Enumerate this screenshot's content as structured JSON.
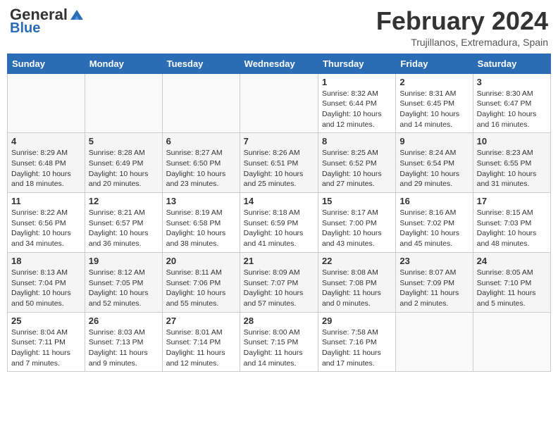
{
  "header": {
    "logo_general": "General",
    "logo_blue": "Blue",
    "month_year": "February 2024",
    "location": "Trujillanos, Extremadura, Spain"
  },
  "weekdays": [
    "Sunday",
    "Monday",
    "Tuesday",
    "Wednesday",
    "Thursday",
    "Friday",
    "Saturday"
  ],
  "weeks": [
    [
      {
        "day": "",
        "info": ""
      },
      {
        "day": "",
        "info": ""
      },
      {
        "day": "",
        "info": ""
      },
      {
        "day": "",
        "info": ""
      },
      {
        "day": "1",
        "info": "Sunrise: 8:32 AM\nSunset: 6:44 PM\nDaylight: 10 hours\nand 12 minutes."
      },
      {
        "day": "2",
        "info": "Sunrise: 8:31 AM\nSunset: 6:45 PM\nDaylight: 10 hours\nand 14 minutes."
      },
      {
        "day": "3",
        "info": "Sunrise: 8:30 AM\nSunset: 6:47 PM\nDaylight: 10 hours\nand 16 minutes."
      }
    ],
    [
      {
        "day": "4",
        "info": "Sunrise: 8:29 AM\nSunset: 6:48 PM\nDaylight: 10 hours\nand 18 minutes."
      },
      {
        "day": "5",
        "info": "Sunrise: 8:28 AM\nSunset: 6:49 PM\nDaylight: 10 hours\nand 20 minutes."
      },
      {
        "day": "6",
        "info": "Sunrise: 8:27 AM\nSunset: 6:50 PM\nDaylight: 10 hours\nand 23 minutes."
      },
      {
        "day": "7",
        "info": "Sunrise: 8:26 AM\nSunset: 6:51 PM\nDaylight: 10 hours\nand 25 minutes."
      },
      {
        "day": "8",
        "info": "Sunrise: 8:25 AM\nSunset: 6:52 PM\nDaylight: 10 hours\nand 27 minutes."
      },
      {
        "day": "9",
        "info": "Sunrise: 8:24 AM\nSunset: 6:54 PM\nDaylight: 10 hours\nand 29 minutes."
      },
      {
        "day": "10",
        "info": "Sunrise: 8:23 AM\nSunset: 6:55 PM\nDaylight: 10 hours\nand 31 minutes."
      }
    ],
    [
      {
        "day": "11",
        "info": "Sunrise: 8:22 AM\nSunset: 6:56 PM\nDaylight: 10 hours\nand 34 minutes."
      },
      {
        "day": "12",
        "info": "Sunrise: 8:21 AM\nSunset: 6:57 PM\nDaylight: 10 hours\nand 36 minutes."
      },
      {
        "day": "13",
        "info": "Sunrise: 8:19 AM\nSunset: 6:58 PM\nDaylight: 10 hours\nand 38 minutes."
      },
      {
        "day": "14",
        "info": "Sunrise: 8:18 AM\nSunset: 6:59 PM\nDaylight: 10 hours\nand 41 minutes."
      },
      {
        "day": "15",
        "info": "Sunrise: 8:17 AM\nSunset: 7:00 PM\nDaylight: 10 hours\nand 43 minutes."
      },
      {
        "day": "16",
        "info": "Sunrise: 8:16 AM\nSunset: 7:02 PM\nDaylight: 10 hours\nand 45 minutes."
      },
      {
        "day": "17",
        "info": "Sunrise: 8:15 AM\nSunset: 7:03 PM\nDaylight: 10 hours\nand 48 minutes."
      }
    ],
    [
      {
        "day": "18",
        "info": "Sunrise: 8:13 AM\nSunset: 7:04 PM\nDaylight: 10 hours\nand 50 minutes."
      },
      {
        "day": "19",
        "info": "Sunrise: 8:12 AM\nSunset: 7:05 PM\nDaylight: 10 hours\nand 52 minutes."
      },
      {
        "day": "20",
        "info": "Sunrise: 8:11 AM\nSunset: 7:06 PM\nDaylight: 10 hours\nand 55 minutes."
      },
      {
        "day": "21",
        "info": "Sunrise: 8:09 AM\nSunset: 7:07 PM\nDaylight: 10 hours\nand 57 minutes."
      },
      {
        "day": "22",
        "info": "Sunrise: 8:08 AM\nSunset: 7:08 PM\nDaylight: 11 hours\nand 0 minutes."
      },
      {
        "day": "23",
        "info": "Sunrise: 8:07 AM\nSunset: 7:09 PM\nDaylight: 11 hours\nand 2 minutes."
      },
      {
        "day": "24",
        "info": "Sunrise: 8:05 AM\nSunset: 7:10 PM\nDaylight: 11 hours\nand 5 minutes."
      }
    ],
    [
      {
        "day": "25",
        "info": "Sunrise: 8:04 AM\nSunset: 7:11 PM\nDaylight: 11 hours\nand 7 minutes."
      },
      {
        "day": "26",
        "info": "Sunrise: 8:03 AM\nSunset: 7:13 PM\nDaylight: 11 hours\nand 9 minutes."
      },
      {
        "day": "27",
        "info": "Sunrise: 8:01 AM\nSunset: 7:14 PM\nDaylight: 11 hours\nand 12 minutes."
      },
      {
        "day": "28",
        "info": "Sunrise: 8:00 AM\nSunset: 7:15 PM\nDaylight: 11 hours\nand 14 minutes."
      },
      {
        "day": "29",
        "info": "Sunrise: 7:58 AM\nSunset: 7:16 PM\nDaylight: 11 hours\nand 17 minutes."
      },
      {
        "day": "",
        "info": ""
      },
      {
        "day": "",
        "info": ""
      }
    ]
  ]
}
